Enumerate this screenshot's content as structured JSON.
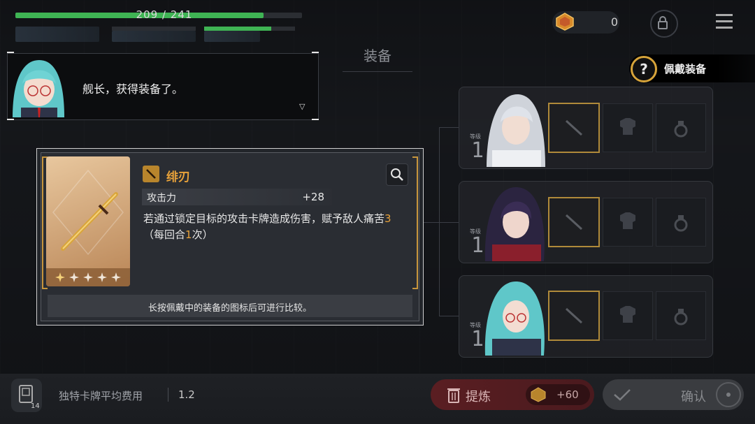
{
  "hud": {
    "hp_text": "209 / 241",
    "hp_fraction": 0.867,
    "currency_value": "0"
  },
  "page": {
    "title": "装备"
  },
  "dialog": {
    "text": "舰长，获得装备了。",
    "continue_glyph": "▽"
  },
  "help": {
    "icon_glyph": "?",
    "text": "佩戴装备"
  },
  "characters": [
    {
      "level_label": "等级",
      "level": "1"
    },
    {
      "level_label": "等级",
      "level": "1"
    },
    {
      "level_label": "等级",
      "level": "1"
    }
  ],
  "item": {
    "name": "绯刃",
    "stars": 5,
    "stat_label": "攻击力",
    "stat_value": "+28",
    "desc_part1": "若通过锁定目标的攻击卡牌造成伤害，赋予敌人痛苦",
    "desc_hl1": "3",
    "desc_part2_prefix": "（每回合",
    "desc_hl2": "1",
    "desc_part2_suffix": "次）",
    "hint": "长按佩戴中的装备的图标后可进行比较。"
  },
  "bottom": {
    "deck_count": "14",
    "avg_label": "独特卡牌平均费用",
    "avg_value": "1.2",
    "refine_label": "提炼",
    "refine_cost": "+60",
    "confirm_label": "确认"
  },
  "colors": {
    "accent_gold": "#e8a23a",
    "hp_green": "#3fb454",
    "refine_red": "#5a1e22"
  }
}
